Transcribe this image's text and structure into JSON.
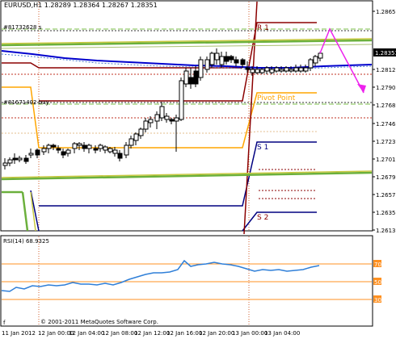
{
  "main": {
    "header": "EURUSD,H1  1.28289 1.28364 1.28267 1.28351",
    "order_labels": [
      "#81732628 s",
      "#81671402 buy"
    ],
    "price_ticks": [
      "1.28650",
      "1.28351",
      "1.28125",
      "1.27900",
      "1.27680",
      "1.27460",
      "1.27230",
      "1.27010",
      "1.26790",
      "1.26575",
      "1.26350",
      "1.26130"
    ],
    "current_price": "1.28351",
    "pivot_labels": {
      "r1": "R 1",
      "pivot": "Pivot Point",
      "s1": "S 1",
      "s2": "S 2"
    }
  },
  "rsi": {
    "title": "RSI(14) 68.9325",
    "levels": [
      "70",
      "50",
      "30"
    ],
    "copyright": "© 2001-2011 MetaQuotes Software Corp."
  },
  "time_axis": [
    "11 Jan 2012",
    "12 Jan 00:00",
    "12 Jan 04:00",
    "12 Jan 08:00",
    "12 Jan 12:00",
    "12 Jan 16:00",
    "12 Jan 20:00",
    "13 Jan 00:00",
    "13 Jan 04:00"
  ],
  "colors": {
    "pivot_orange": "#ffa500",
    "r1_darkred": "#8b0000",
    "s_navy": "#000080",
    "ma_blue": "#0000cd",
    "grid_green": "#6bb03c",
    "arrow_magenta": "#ee22ee",
    "rsi_line": "#2f7fd8",
    "level_orange": "#ff9020"
  }
}
